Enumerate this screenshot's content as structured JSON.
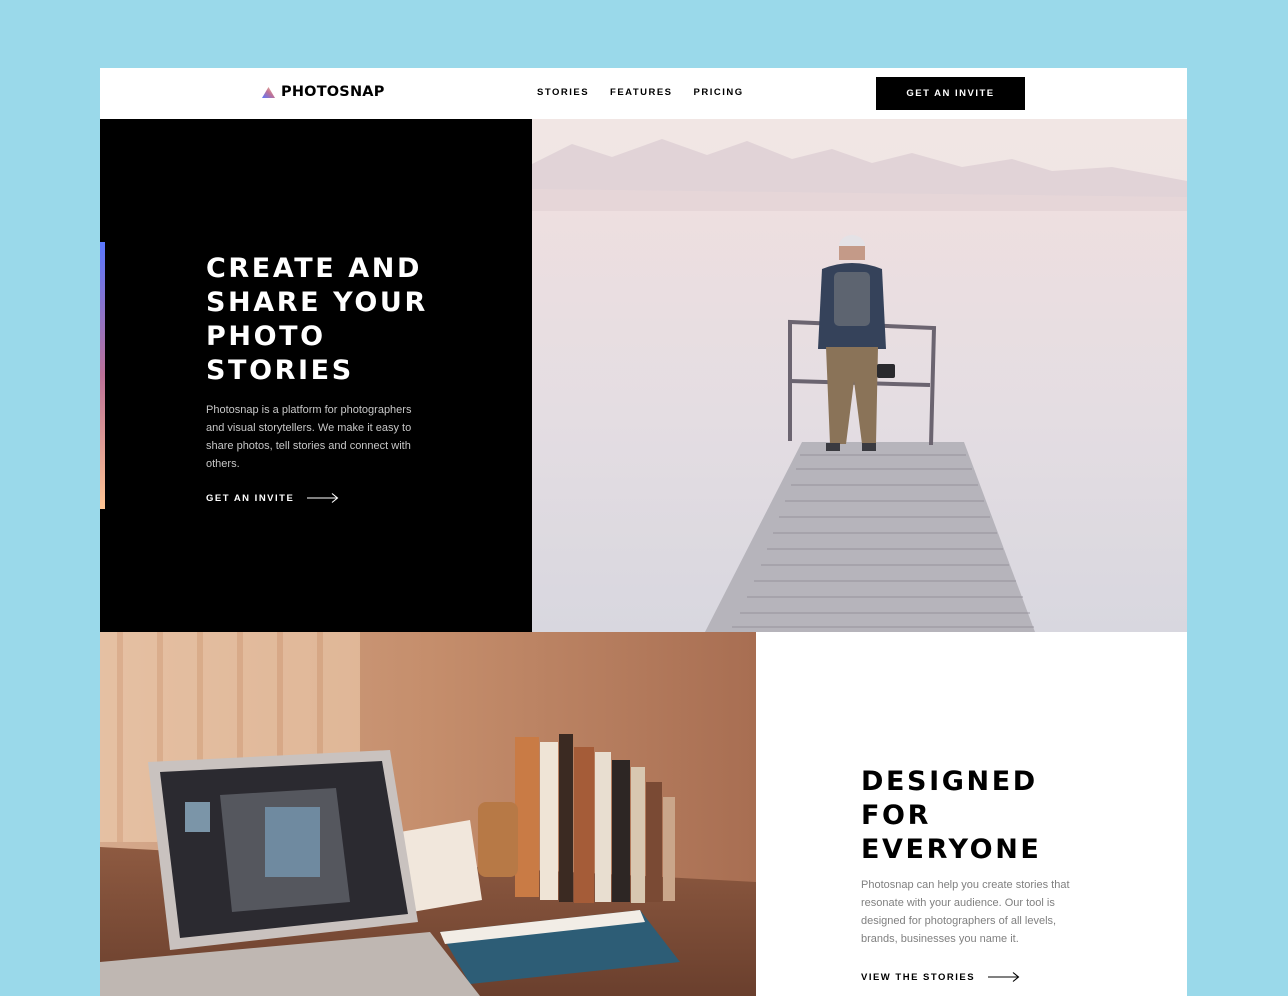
{
  "colors": {
    "page_background": "#9ad9ea",
    "dark_panel": "#000000",
    "accent_gradient": [
      "#ffc593",
      "#bc7198",
      "#5a77ff"
    ]
  },
  "header": {
    "logo_text": "PHOTOSNAP",
    "nav": [
      "STORIES",
      "FEATURES",
      "PRICING"
    ],
    "cta_label": "GET AN INVITE"
  },
  "hero": {
    "title_lines": [
      "CREATE AND",
      "SHARE YOUR",
      "PHOTO",
      "STORIES"
    ],
    "description": "Photosnap is a platform for photographers and visual storytellers. We make it easy to share photos, tell stories and connect with others.",
    "link_label": "GET AN INVITE",
    "image": "man-standing-on-lake-pier-photo"
  },
  "designed": {
    "title_lines": [
      "DESIGNED",
      "FOR",
      "EVERYONE"
    ],
    "description": "Photosnap can help you create stories that resonate with your audience. Our tool is designed for photographers of all levels, brands, businesses you name it.",
    "link_label": "VIEW THE STORIES",
    "image": "laptop-on-desk-photo"
  }
}
